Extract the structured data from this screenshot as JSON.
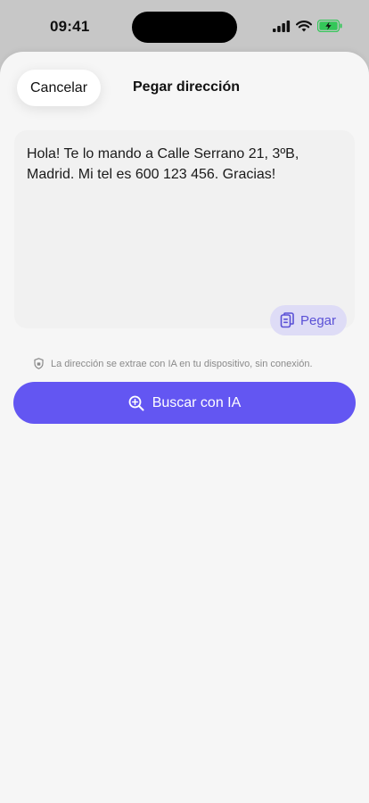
{
  "status_bar": {
    "time": "09:41",
    "icons": [
      "signal-icon",
      "wifi-icon",
      "battery-charging-icon"
    ]
  },
  "header": {
    "cancel_label": "Cancelar",
    "title": "Pegar dirección"
  },
  "address_input": {
    "value": "Hola! Te lo mando a Calle Serrano 21, 3ºB, Madrid. Mi tel es 600 123 456. Gracias!"
  },
  "paste_button": {
    "label": "Pegar",
    "icon": "clipboard-icon"
  },
  "privacy_note": {
    "text": "La dirección se extrae con IA en tu dispositivo, sin conexión.",
    "icon": "shield-icon"
  },
  "search_button": {
    "label": "Buscar con IA",
    "icon": "magnifier-plus-icon"
  },
  "colors": {
    "accent": "#6356f2",
    "accent_soft": "#dedcf6",
    "sheet_background": "#f6f6f6",
    "battery": "#34c759"
  }
}
